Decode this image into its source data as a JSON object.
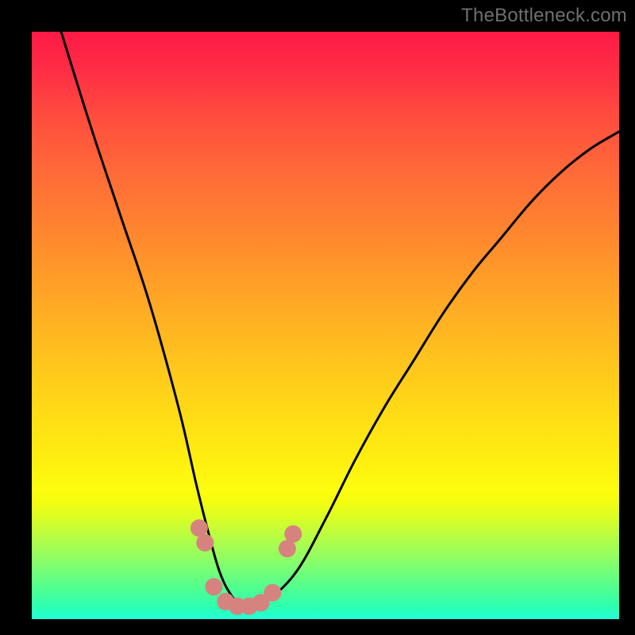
{
  "watermark": "TheBottleneck.com",
  "chart_data": {
    "type": "line",
    "title": "",
    "xlabel": "",
    "ylabel": "",
    "xlim": [
      0,
      100
    ],
    "ylim": [
      0,
      100
    ],
    "grid": false,
    "series": [
      {
        "name": "curve",
        "x": [
          5,
          10,
          15,
          20,
          25,
          28,
          30,
          32,
          34,
          36,
          38,
          40,
          45,
          50,
          55,
          60,
          65,
          70,
          75,
          80,
          85,
          90,
          95,
          100
        ],
        "y": [
          100,
          84,
          69,
          54,
          36,
          23,
          15,
          8,
          4,
          2,
          2,
          3,
          8,
          17,
          27,
          36,
          44,
          52,
          59,
          65,
          71,
          76,
          80,
          83
        ]
      }
    ],
    "markers": {
      "name": "bottom-cluster",
      "color": "#d6837f",
      "points": [
        {
          "x": 28.5,
          "y": 15.5
        },
        {
          "x": 29.5,
          "y": 13.0
        },
        {
          "x": 31.0,
          "y": 5.5
        },
        {
          "x": 33.0,
          "y": 3.0
        },
        {
          "x": 35.0,
          "y": 2.2
        },
        {
          "x": 37.0,
          "y": 2.2
        },
        {
          "x": 39.0,
          "y": 2.8
        },
        {
          "x": 41.0,
          "y": 4.5
        },
        {
          "x": 43.5,
          "y": 12.0
        },
        {
          "x": 44.5,
          "y": 14.5
        }
      ]
    },
    "gradient_stops": {
      "top": "#fe1a46",
      "mid": "#ffc41d",
      "lower": "#fdfd0f",
      "bottom": "#24fed1"
    }
  }
}
